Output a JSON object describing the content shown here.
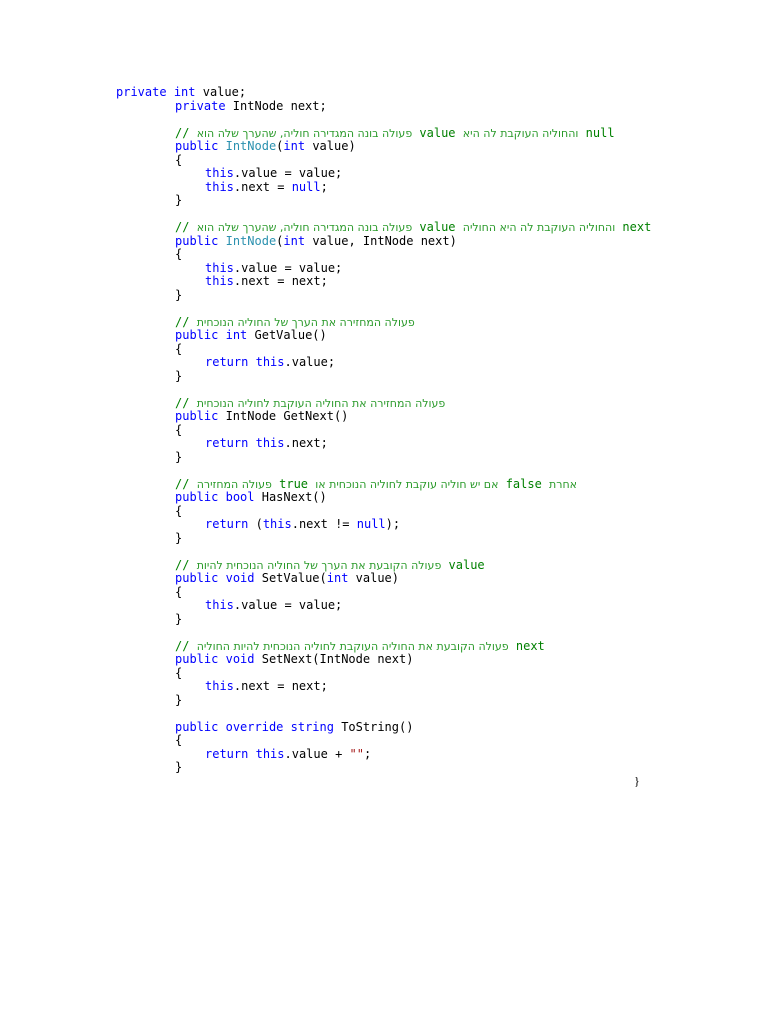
{
  "colors": {
    "keyword": "#0000ff",
    "type": "#2b91af",
    "comment": "#008000",
    "string": "#a31515"
  },
  "code_lines": [
    {
      "i": 0,
      "tk": [
        [
          "kw",
          "private"
        ],
        [
          "tx",
          " "
        ],
        [
          "kw",
          "int"
        ],
        [
          "tx",
          " value;"
        ]
      ]
    },
    {
      "i": 1,
      "tk": [
        [
          "kw",
          "private"
        ],
        [
          "tx",
          " IntNode next;"
        ]
      ]
    },
    {
      "i": 1,
      "tk": []
    },
    {
      "i": 1,
      "tk": [
        [
          "cm",
          "// "
        ],
        [
          "he",
          "פעולה בונה המגדירה חוליה, שהערך שלה הוא"
        ],
        [
          "cm",
          " value "
        ],
        [
          "he",
          "והחוליה העוקבת לה היא"
        ],
        [
          "cm",
          " null"
        ]
      ]
    },
    {
      "i": 1,
      "tk": [
        [
          "kw",
          "public"
        ],
        [
          "tx",
          " "
        ],
        [
          "ty",
          "IntNode"
        ],
        [
          "tx",
          "("
        ],
        [
          "kw",
          "int"
        ],
        [
          "tx",
          " value)"
        ]
      ]
    },
    {
      "i": 1,
      "tk": [
        [
          "tx",
          "{"
        ]
      ]
    },
    {
      "i": 2,
      "tk": [
        [
          "kw",
          "this"
        ],
        [
          "tx",
          ".value = value;"
        ]
      ]
    },
    {
      "i": 2,
      "tk": [
        [
          "kw",
          "this"
        ],
        [
          "tx",
          ".next = "
        ],
        [
          "kw",
          "null"
        ],
        [
          "tx",
          ";"
        ]
      ]
    },
    {
      "i": 1,
      "tk": [
        [
          "tx",
          "}"
        ]
      ]
    },
    {
      "i": 1,
      "tk": []
    },
    {
      "i": 1,
      "tk": [
        [
          "cm",
          "// "
        ],
        [
          "he",
          "פעולה בונה המגדירה חוליה, שהערך שלה הוא"
        ],
        [
          "cm",
          " value "
        ],
        [
          "he",
          "והחוליה העוקבת לה היא החוליה"
        ],
        [
          "cm",
          " next"
        ]
      ]
    },
    {
      "i": 1,
      "tk": [
        [
          "kw",
          "public"
        ],
        [
          "tx",
          " "
        ],
        [
          "ty",
          "IntNode"
        ],
        [
          "tx",
          "("
        ],
        [
          "kw",
          "int"
        ],
        [
          "tx",
          " value, IntNode next)"
        ]
      ]
    },
    {
      "i": 1,
      "tk": [
        [
          "tx",
          "{"
        ]
      ]
    },
    {
      "i": 2,
      "tk": [
        [
          "kw",
          "this"
        ],
        [
          "tx",
          ".value = value;"
        ]
      ]
    },
    {
      "i": 2,
      "tk": [
        [
          "kw",
          "this"
        ],
        [
          "tx",
          ".next = next;"
        ]
      ]
    },
    {
      "i": 1,
      "tk": [
        [
          "tx",
          "}"
        ]
      ]
    },
    {
      "i": 1,
      "tk": []
    },
    {
      "i": 1,
      "tk": [
        [
          "cm",
          "// "
        ],
        [
          "he",
          "פעולה המחזירה את הערך של החוליה הנוכחית"
        ]
      ]
    },
    {
      "i": 1,
      "tk": [
        [
          "kw",
          "public"
        ],
        [
          "tx",
          " "
        ],
        [
          "kw",
          "int"
        ],
        [
          "tx",
          " GetValue()"
        ]
      ]
    },
    {
      "i": 1,
      "tk": [
        [
          "tx",
          "{"
        ]
      ]
    },
    {
      "i": 2,
      "tk": [
        [
          "kw",
          "return"
        ],
        [
          "tx",
          " "
        ],
        [
          "kw",
          "this"
        ],
        [
          "tx",
          ".value;"
        ]
      ]
    },
    {
      "i": 1,
      "tk": [
        [
          "tx",
          "}"
        ]
      ]
    },
    {
      "i": 1,
      "tk": []
    },
    {
      "i": 1,
      "tk": [
        [
          "cm",
          "// "
        ],
        [
          "he",
          "פעולה המחזירה את החוליה העוקבת לחוליה הנוכחית"
        ]
      ]
    },
    {
      "i": 1,
      "tk": [
        [
          "kw",
          "public"
        ],
        [
          "tx",
          " IntNode GetNext()"
        ]
      ]
    },
    {
      "i": 1,
      "tk": [
        [
          "tx",
          "{"
        ]
      ]
    },
    {
      "i": 2,
      "tk": [
        [
          "kw",
          "return"
        ],
        [
          "tx",
          " "
        ],
        [
          "kw",
          "this"
        ],
        [
          "tx",
          ".next;"
        ]
      ]
    },
    {
      "i": 1,
      "tk": [
        [
          "tx",
          "}"
        ]
      ]
    },
    {
      "i": 1,
      "tk": []
    },
    {
      "i": 1,
      "tk": [
        [
          "cm",
          "// "
        ],
        [
          "he",
          "פעולה המחזירה"
        ],
        [
          "cm",
          " true "
        ],
        [
          "he",
          "אם יש חוליה עוקבת לחוליה הנוכחית או"
        ],
        [
          "cm",
          " false "
        ],
        [
          "he",
          "אחרת"
        ]
      ]
    },
    {
      "i": 1,
      "tk": [
        [
          "kw",
          "public"
        ],
        [
          "tx",
          " "
        ],
        [
          "kw",
          "bool"
        ],
        [
          "tx",
          " HasNext()"
        ]
      ]
    },
    {
      "i": 1,
      "tk": [
        [
          "tx",
          "{"
        ]
      ]
    },
    {
      "i": 2,
      "tk": [
        [
          "kw",
          "return"
        ],
        [
          "tx",
          " ("
        ],
        [
          "kw",
          "this"
        ],
        [
          "tx",
          ".next != "
        ],
        [
          "kw",
          "null"
        ],
        [
          "tx",
          ");"
        ]
      ]
    },
    {
      "i": 1,
      "tk": [
        [
          "tx",
          "}"
        ]
      ]
    },
    {
      "i": 1,
      "tk": []
    },
    {
      "i": 1,
      "tk": [
        [
          "cm",
          "// "
        ],
        [
          "he",
          "פעולה הקובעת את הערך של החוליה הנוכחית להיות"
        ],
        [
          "cm",
          " value"
        ]
      ]
    },
    {
      "i": 1,
      "tk": [
        [
          "kw",
          "public"
        ],
        [
          "tx",
          " "
        ],
        [
          "kw",
          "void"
        ],
        [
          "tx",
          " SetValue("
        ],
        [
          "kw",
          "int"
        ],
        [
          "tx",
          " value)"
        ]
      ]
    },
    {
      "i": 1,
      "tk": [
        [
          "tx",
          "{"
        ]
      ]
    },
    {
      "i": 2,
      "tk": [
        [
          "kw",
          "this"
        ],
        [
          "tx",
          ".value = value;"
        ]
      ]
    },
    {
      "i": 1,
      "tk": [
        [
          "tx",
          "}"
        ]
      ]
    },
    {
      "i": 1,
      "tk": []
    },
    {
      "i": 1,
      "tk": [
        [
          "cm",
          "// "
        ],
        [
          "he",
          "פעולה הקובעת את החוליה העוקבת לחוליה הנוכחית להיות החוליה"
        ],
        [
          "cm",
          " next"
        ]
      ]
    },
    {
      "i": 1,
      "tk": [
        [
          "kw",
          "public"
        ],
        [
          "tx",
          " "
        ],
        [
          "kw",
          "void"
        ],
        [
          "tx",
          " SetNext(IntNode next)"
        ]
      ]
    },
    {
      "i": 1,
      "tk": [
        [
          "tx",
          "{"
        ]
      ]
    },
    {
      "i": 2,
      "tk": [
        [
          "kw",
          "this"
        ],
        [
          "tx",
          ".next = next;"
        ]
      ]
    },
    {
      "i": 1,
      "tk": [
        [
          "tx",
          "}"
        ]
      ]
    },
    {
      "i": 1,
      "tk": []
    },
    {
      "i": 1,
      "tk": [
        [
          "kw",
          "public"
        ],
        [
          "tx",
          " "
        ],
        [
          "kw",
          "override"
        ],
        [
          "tx",
          " "
        ],
        [
          "kw",
          "string"
        ],
        [
          "tx",
          " ToString()"
        ]
      ]
    },
    {
      "i": 1,
      "tk": [
        [
          "tx",
          "{"
        ]
      ]
    },
    {
      "i": 2,
      "tk": [
        [
          "kw",
          "return"
        ],
        [
          "tx",
          " "
        ],
        [
          "kw",
          "this"
        ],
        [
          "tx",
          ".value + "
        ],
        [
          "st",
          "\"\""
        ],
        [
          "tx",
          ";"
        ]
      ]
    },
    {
      "i": 1,
      "tk": [
        [
          "tx",
          "}"
        ]
      ]
    }
  ],
  "closing_brace": "}"
}
